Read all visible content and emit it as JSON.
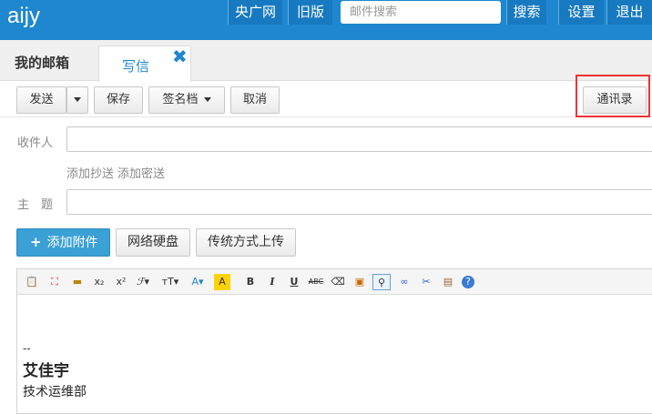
{
  "header": {
    "logo": "aijy",
    "nav": [
      "央广网",
      "旧版"
    ],
    "search_placeholder": "邮件搜索",
    "search_button": "搜索",
    "settings": "设置",
    "logout": "退出"
  },
  "tabs": {
    "mailbox": "我的邮箱",
    "compose": "写信"
  },
  "toolbar": {
    "send": "发送",
    "save": "保存",
    "signature": "签名档",
    "cancel": "取消",
    "contacts": "通讯录"
  },
  "form": {
    "to_label": "收件人",
    "cc_link": "添加抄送",
    "bcc_link": "添加密送",
    "subject_label": "主　题",
    "attach_button": "添加附件",
    "disk_button": "网络硬盘",
    "upload_button": "传统方式上传"
  },
  "editor": {
    "icons": [
      "paste-icon",
      "fullscreen-icon",
      "insert-line-icon",
      "subscript-icon",
      "superscript-icon",
      "font-family-icon",
      "font-size-icon",
      "font-color-icon",
      "highlight-icon",
      "bold-icon",
      "italic-icon",
      "underline-icon",
      "strikethrough-icon",
      "eraser-icon",
      "image-icon",
      "attachment-icon",
      "link-icon",
      "unlink-icon",
      "paste-word-icon",
      "help-icon"
    ],
    "signature_dash": "--",
    "signature_name": "艾佳宇",
    "signature_dept": "技术运维部"
  },
  "colors": {
    "brand": "#1e87cf",
    "attach_button": "#3aa0d6",
    "highlight_border": "#ee3333"
  }
}
